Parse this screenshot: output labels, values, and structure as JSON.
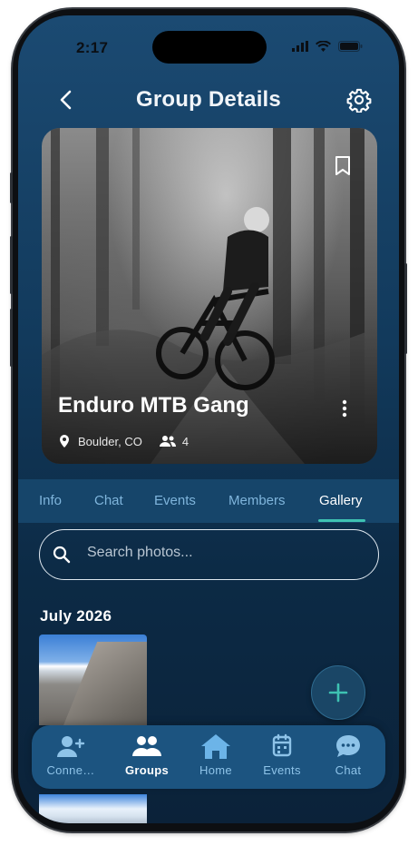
{
  "status_bar": {
    "time": "2:17"
  },
  "header": {
    "title": "Group Details"
  },
  "group": {
    "name": "Enduro MTB Gang",
    "location": "Boulder, CO",
    "member_count": "4"
  },
  "tabs": [
    {
      "label": "Info"
    },
    {
      "label": "Chat"
    },
    {
      "label": "Events"
    },
    {
      "label": "Members"
    },
    {
      "label": "Gallery",
      "active": true
    }
  ],
  "search": {
    "placeholder": "Search photos..."
  },
  "gallery": {
    "section_title": "July 2026"
  },
  "bottom_nav": [
    {
      "label": "Conne…",
      "icon": "connect-icon"
    },
    {
      "label": "Groups",
      "icon": "groups-icon",
      "active": true
    },
    {
      "label": "Home",
      "icon": "home-icon"
    },
    {
      "label": "Events",
      "icon": "calendar-icon"
    },
    {
      "label": "Chat",
      "icon": "chat-bubble-icon"
    }
  ],
  "colors": {
    "accent": "#3ec2b2",
    "background": "#123a5c",
    "nav_background": "#1c5480"
  }
}
